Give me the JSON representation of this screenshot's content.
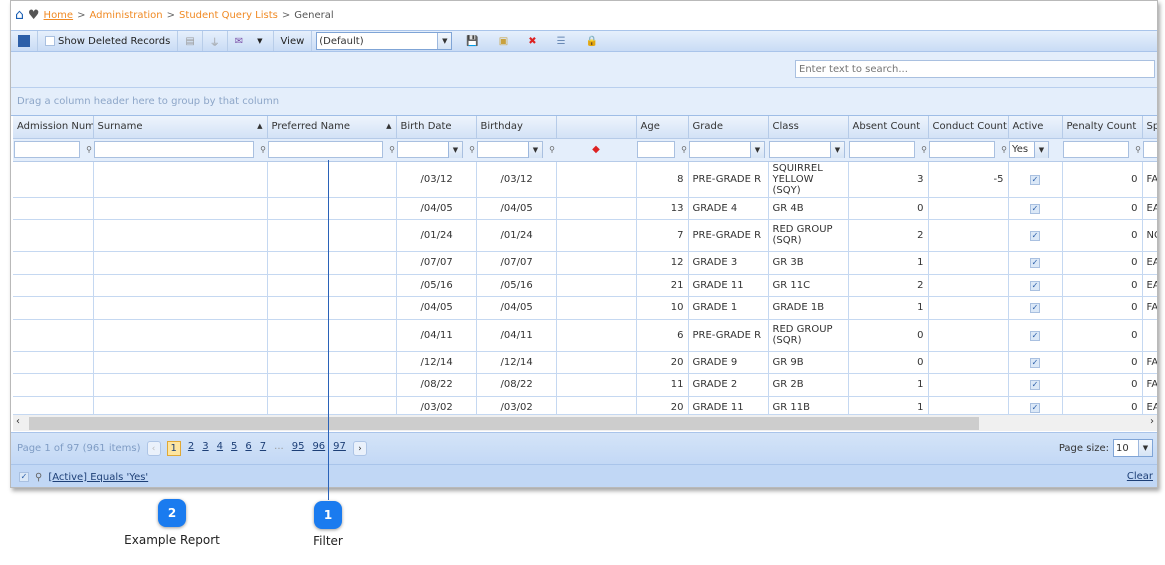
{
  "breadcrumb": {
    "home": "Home",
    "items": [
      "Administration",
      "Student Query Lists"
    ],
    "current": "General",
    "separator": ">"
  },
  "toolbar": {
    "show_deleted": "Show Deleted Records",
    "view_label": "View",
    "view_value": "(Default)"
  },
  "search": {
    "placeholder": "Enter text to search..."
  },
  "group_panel": "Drag a column header here to group by that column",
  "columns": [
    "Admission Numb",
    "Surname",
    "Preferred Name",
    "Birth Date",
    "Birthday",
    "",
    "Age",
    "Grade",
    "Class",
    "Absent Count",
    "Conduct Count",
    "Active",
    "Penalty Count",
    "Sp"
  ],
  "filter_active_value": "Yes",
  "rows": [
    [
      "",
      "",
      "",
      "/03/12",
      "/03/12",
      "",
      "8",
      "PRE-GRADE R",
      "SQUIRREL YELLOW (SQY)",
      "3",
      "-5",
      true,
      "0",
      "FA"
    ],
    [
      "",
      "",
      "",
      "/04/05",
      "/04/05",
      "",
      "13",
      "GRADE 4",
      "GR 4B",
      "0",
      "",
      true,
      "0",
      "EA"
    ],
    [
      "",
      "",
      "",
      "/01/24",
      "/01/24",
      "",
      "7",
      "PRE-GRADE R",
      "RED GROUP (SQR)",
      "2",
      "",
      true,
      "0",
      "NO"
    ],
    [
      "",
      "",
      "",
      "/07/07",
      "/07/07",
      "",
      "12",
      "GRADE 3",
      "GR 3B",
      "1",
      "",
      true,
      "0",
      "EA"
    ],
    [
      "",
      "",
      "",
      "/05/16",
      "/05/16",
      "",
      "21",
      "GRADE 11",
      "GR 11C",
      "2",
      "",
      true,
      "0",
      "EA"
    ],
    [
      "",
      "",
      "",
      "/04/05",
      "/04/05",
      "",
      "10",
      "GRADE 1",
      "GRADE 1B",
      "1",
      "",
      true,
      "0",
      "FA"
    ],
    [
      "",
      "",
      "",
      "/04/11",
      "/04/11",
      "",
      "6",
      "PRE-GRADE R",
      "RED GROUP (SQR)",
      "0",
      "",
      true,
      "0",
      ""
    ],
    [
      "",
      "",
      "",
      "/12/14",
      "/12/14",
      "",
      "20",
      "GRADE 9",
      "GR 9B",
      "0",
      "",
      true,
      "0",
      "FA"
    ],
    [
      "",
      "",
      "",
      "/08/22",
      "/08/22",
      "",
      "11",
      "GRADE 2",
      "GR 2B",
      "1",
      "",
      true,
      "0",
      "FA"
    ],
    [
      "",
      "",
      "",
      "/03/02",
      "/03/02",
      "",
      "20",
      "GRADE 11",
      "GR 11B",
      "1",
      "",
      true,
      "0",
      "EA"
    ]
  ],
  "pager": {
    "info": "Page 1 of 97 (961 items)",
    "pages": [
      "1",
      "2",
      "3",
      "4",
      "5",
      "6",
      "7",
      "...",
      "95",
      "96",
      "97"
    ],
    "current": "1",
    "page_size_label": "Page size:",
    "page_size": "10"
  },
  "filter_bar": {
    "expression": "[Active] Equals 'Yes'",
    "clear": "Clear"
  },
  "callouts": [
    {
      "number": "1",
      "label": "Filter"
    },
    {
      "number": "2",
      "label": "Example Report"
    }
  ]
}
